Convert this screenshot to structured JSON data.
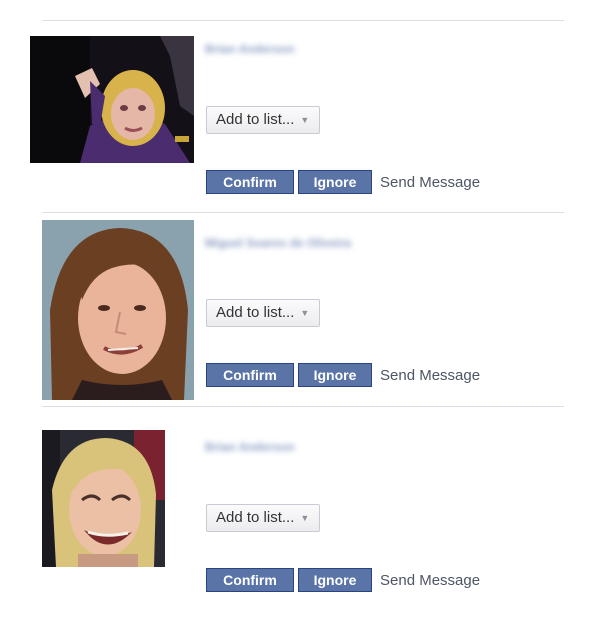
{
  "requests": [
    {
      "name": "Brian Anderson",
      "add_to_list_label": "Add to list...",
      "confirm_label": "Confirm",
      "ignore_label": "Ignore",
      "send_message_label": "Send Message"
    },
    {
      "name": "Miguel Soares de Oliveira",
      "add_to_list_label": "Add to list...",
      "confirm_label": "Confirm",
      "ignore_label": "Ignore",
      "send_message_label": "Send Message"
    },
    {
      "name": "Brian Anderson",
      "add_to_list_label": "Add to list...",
      "confirm_label": "Confirm",
      "ignore_label": "Ignore",
      "send_message_label": "Send Message"
    }
  ],
  "colors": {
    "button_blue": "#5b74a8",
    "button_border": "#29447e",
    "separator": "#dcdfe5"
  },
  "icons": {
    "dropdown": "chevron-down-icon"
  }
}
